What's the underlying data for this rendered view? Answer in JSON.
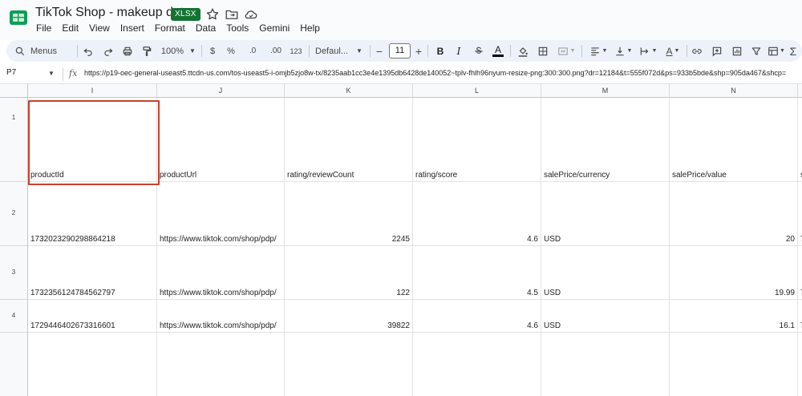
{
  "app": {
    "title": "TikTok Shop - makeup data",
    "file_badge": "XLSX",
    "brand_color": "#0f9d58"
  },
  "menu": [
    "File",
    "Edit",
    "View",
    "Insert",
    "Format",
    "Data",
    "Tools",
    "Gemini",
    "Help"
  ],
  "toolbar": {
    "search_label": "Menus",
    "zoom": "100%",
    "currency": "$",
    "percent": "%",
    "dec_decrease": ".0",
    "dec_increase": ".00",
    "number_format": "123",
    "font_name": "Defaul...",
    "font_size": "11",
    "minus": "−",
    "plus": "+",
    "bold": "B",
    "italic": "I",
    "text_color_letter": "A",
    "icons": [
      "search-icon",
      "undo-icon",
      "redo-icon",
      "print-icon",
      "paint-format-icon",
      "zoom-dropdown",
      "currency-icon",
      "percent-icon",
      "decrease-decimal-icon",
      "increase-decimal-icon",
      "number-format-icon",
      "font-dropdown",
      "font-size-decrease",
      "font-size-increase",
      "bold-icon",
      "italic-icon",
      "strikethrough-icon",
      "text-color-icon",
      "fill-color-icon",
      "borders-icon",
      "merge-icon",
      "align-icon",
      "valign-icon",
      "text-wrap-icon",
      "text-rotate-icon",
      "link-icon",
      "comment-icon",
      "chart-icon",
      "filter-icon",
      "filter-views-icon",
      "functions-icon"
    ],
    "accent": "#edf2fa"
  },
  "formula_bar": {
    "name_box": "P7",
    "fx": "fx",
    "formula": "https://p19-oec-general-useast5.ttcdn-us.com/tos-useast5-i-omjb5zjo8w-tx/8235aab1cc3e4e1395db6428de140052~tplv-fhlh96nyum-resize-png:300:300.png?dr=12184&t=555f072d&ps=933b5bde&shp=905da467&shcp="
  },
  "grid": {
    "columns": [
      "I",
      "J",
      "K",
      "L",
      "M",
      "N",
      ""
    ],
    "rows": [
      {
        "num": "1",
        "cells": [
          "productId",
          "productUrl",
          "rating/reviewCount",
          "rating/score",
          "salePrice/currency",
          "salePrice/value",
          "s"
        ]
      },
      {
        "num": "2",
        "cells": [
          "1732023290298864218",
          "https://www.tiktok.com/shop/pdp/",
          "2245",
          "4.6",
          "USD",
          "20",
          "7"
        ]
      },
      {
        "num": "3",
        "cells": [
          "1732356124784562797",
          "https://www.tiktok.com/shop/pdp/",
          "122",
          "4.5",
          "USD",
          "19.99",
          "7"
        ]
      },
      {
        "num": "4",
        "cells": [
          "1729446402673316601",
          "https://www.tiktok.com/shop/pdp/",
          "39822",
          "4.6",
          "USD",
          "16.1",
          "7"
        ]
      },
      {
        "num": "",
        "cells": [
          "",
          "",
          "",
          "",
          "",
          "",
          ""
        ]
      }
    ],
    "numeric_columns": [
      2,
      3,
      5
    ],
    "selection_color": "#c8412c"
  }
}
